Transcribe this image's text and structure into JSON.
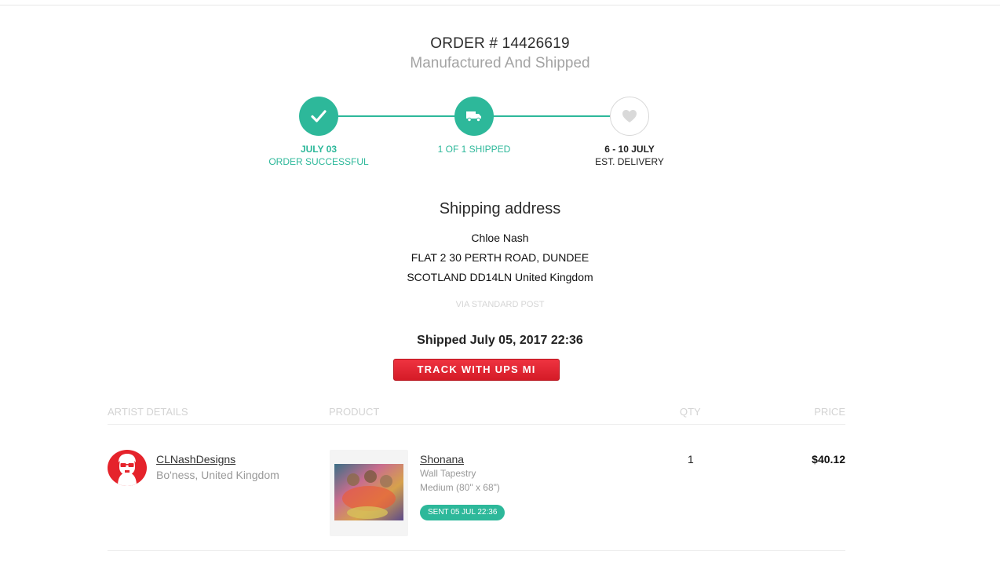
{
  "order": {
    "title": "ORDER # 14426619",
    "status": "Manufactured And Shipped"
  },
  "progress": {
    "accent_color": "#2db89a",
    "steps": [
      {
        "line1": "JULY 03",
        "line2": "ORDER SUCCESSFUL",
        "icon": "checkmark-icon",
        "state": "complete"
      },
      {
        "line1": "",
        "line2": "1 OF 1 SHIPPED",
        "icon": "truck-icon",
        "state": "complete"
      },
      {
        "line1": "6 - 10 JULY",
        "line2": "EST. DELIVERY",
        "icon": "heart-icon",
        "state": "pending"
      }
    ]
  },
  "shipping": {
    "heading": "Shipping address",
    "address_lines": [
      "Chloe Nash",
      "FLAT 2 30 PERTH ROAD, DUNDEE",
      "SCOTLAND DD14LN United Kingdom"
    ],
    "method": "VIA STANDARD POST",
    "shipped_text": "Shipped July 05, 2017 22:36",
    "track_label": "TRACK WITH UPS MI",
    "track_color": "#e5232b"
  },
  "table": {
    "headers": {
      "artist": "ARTIST DETAILS",
      "product": "PRODUCT",
      "qty": "QTY",
      "price": "PRICE"
    },
    "rows": [
      {
        "artist_name": "CLNashDesigns",
        "artist_location": "Bo'ness, United Kingdom",
        "product_name": "Shonana",
        "product_type": "Wall Tapestry",
        "product_size": "Medium (80\" x 68\")",
        "status_badge": "SENT 05 JUL 22:36",
        "qty": "1",
        "price": "$40.12"
      }
    ]
  }
}
